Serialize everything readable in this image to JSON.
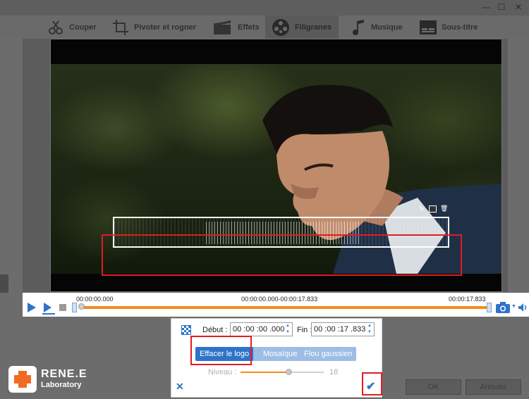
{
  "window": {
    "minimize": "—",
    "maximize": "☐",
    "close": "✕"
  },
  "tabs": [
    {
      "label": "Couper",
      "icon": "cut-icon"
    },
    {
      "label": "Pivoter et rogner",
      "icon": "crop-icon"
    },
    {
      "label": "Effets",
      "icon": "effects-icon"
    },
    {
      "label": "Filigranes",
      "icon": "watermark-icon",
      "active": true
    },
    {
      "label": "Musique",
      "icon": "music-icon"
    },
    {
      "label": "Sous-titre",
      "icon": "subtitle-icon"
    }
  ],
  "timeline": {
    "start": "00:00:00.000",
    "range": "00:00:00.000-00:00:17.833",
    "end": "00:00:17.833"
  },
  "panel": {
    "start_label": "Début :",
    "start_value": "00 :00 :00 .000",
    "end_label": "Fin :",
    "end_value": "00 :00 :17 .833",
    "modes": [
      "Effacer le logo",
      "Mosaïque",
      "Flou gaussien"
    ],
    "selected_mode": "Effacer le logo",
    "level_label": "Niveau :",
    "level_value": "18"
  },
  "logo": {
    "line1": "RENE.E",
    "line2": "Laboratory"
  },
  "buttons": {
    "ok": "OK",
    "cancel": "Annuler"
  },
  "colors": {
    "accent": "#2d74c9",
    "highlight": "#e31b23",
    "progress": "#f28c1e"
  }
}
